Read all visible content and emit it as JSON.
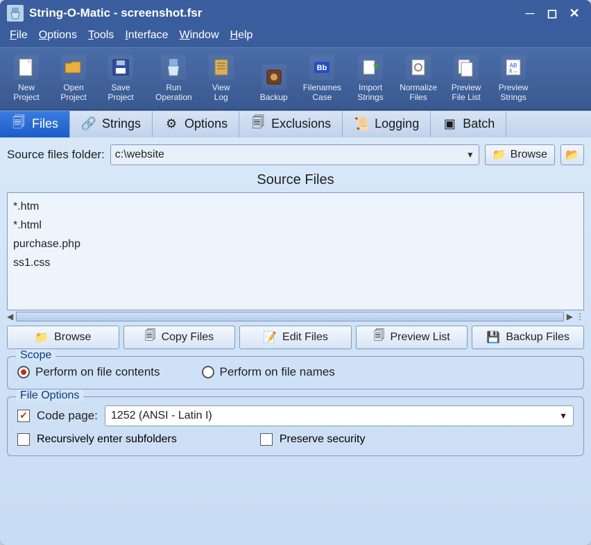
{
  "titlebar": {
    "title": "String-O-Matic - screenshot.fsr"
  },
  "menu": {
    "file": "File",
    "options": "Options",
    "tools": "Tools",
    "interface": "Interface",
    "window": "Window",
    "help": "Help"
  },
  "toolbar": {
    "new_project": "New\nProject",
    "open_project": "Open\nProject",
    "save_project": "Save\nProject",
    "run_operation": "Run\nOperation",
    "view_log": "View\nLog",
    "backup": "Backup",
    "filenames_case": "Filenames\nCase",
    "import_strings": "Import\nStrings",
    "normalize_files": "Normalize\nFiles",
    "preview_file_list": "Preview\nFile List",
    "preview_strings": "Preview\nStrings"
  },
  "tabs": {
    "files": "Files",
    "strings": "Strings",
    "options": "Options",
    "exclusions": "Exclusions",
    "logging": "Logging",
    "batch": "Batch"
  },
  "source": {
    "label": "Source files folder:",
    "value": "c:\\website",
    "browse": "Browse"
  },
  "section_title": "Source Files",
  "file_list": [
    "*.htm",
    "*.html",
    "purchase.php",
    "ss1.css"
  ],
  "buttons": {
    "browse": "Browse",
    "copy_files": "Copy Files",
    "edit_files": "Edit Files",
    "preview_list": "Preview List",
    "backup_files": "Backup Files"
  },
  "scope": {
    "legend": "Scope",
    "contents": "Perform on file contents",
    "names": "Perform on file names",
    "selected": "contents"
  },
  "file_options": {
    "legend": "File Options",
    "code_page_label": "Code page:",
    "code_page_value": "1252 (ANSI - Latin I)",
    "recursive": "Recursively enter subfolders",
    "preserve_security": "Preserve security",
    "code_page_checked": true,
    "recursive_checked": false,
    "preserve_checked": false
  }
}
